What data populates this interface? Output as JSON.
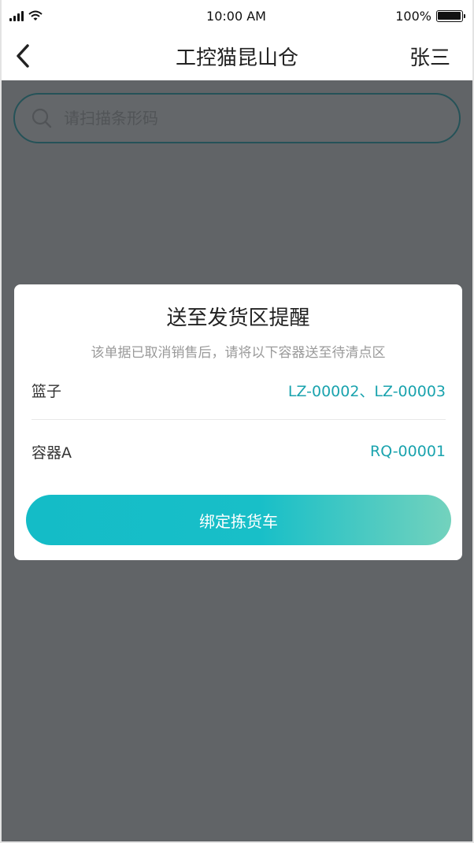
{
  "status_bar": {
    "time": "10:00 AM",
    "battery_percent": "100%",
    "battery_level": 1.0,
    "signal_icon": "cellular-signal-icon",
    "wifi_icon": "wifi-icon",
    "battery_icon": "battery-icon"
  },
  "nav": {
    "back_icon": "chevron-left-icon",
    "title": "工控猫昆山仓",
    "user": "张三"
  },
  "search": {
    "icon": "search-icon",
    "placeholder": "请扫描条形码",
    "value": ""
  },
  "modal": {
    "title": "送至发货区提醒",
    "description": "该单据已取消销售后，请将以下容器送至待清点区",
    "rows": [
      {
        "label": "篮子",
        "value": "LZ-00002、LZ-00003"
      },
      {
        "label": "容器A",
        "value": "RQ-00001"
      }
    ],
    "button_label": "绑定拣货车"
  },
  "colors": {
    "accent": "#1fb5bd",
    "value_text": "#1aa3ae",
    "button_gradient_start": "#14bcc7",
    "button_gradient_end": "#73d2bd",
    "overlay": "#5f6468"
  }
}
